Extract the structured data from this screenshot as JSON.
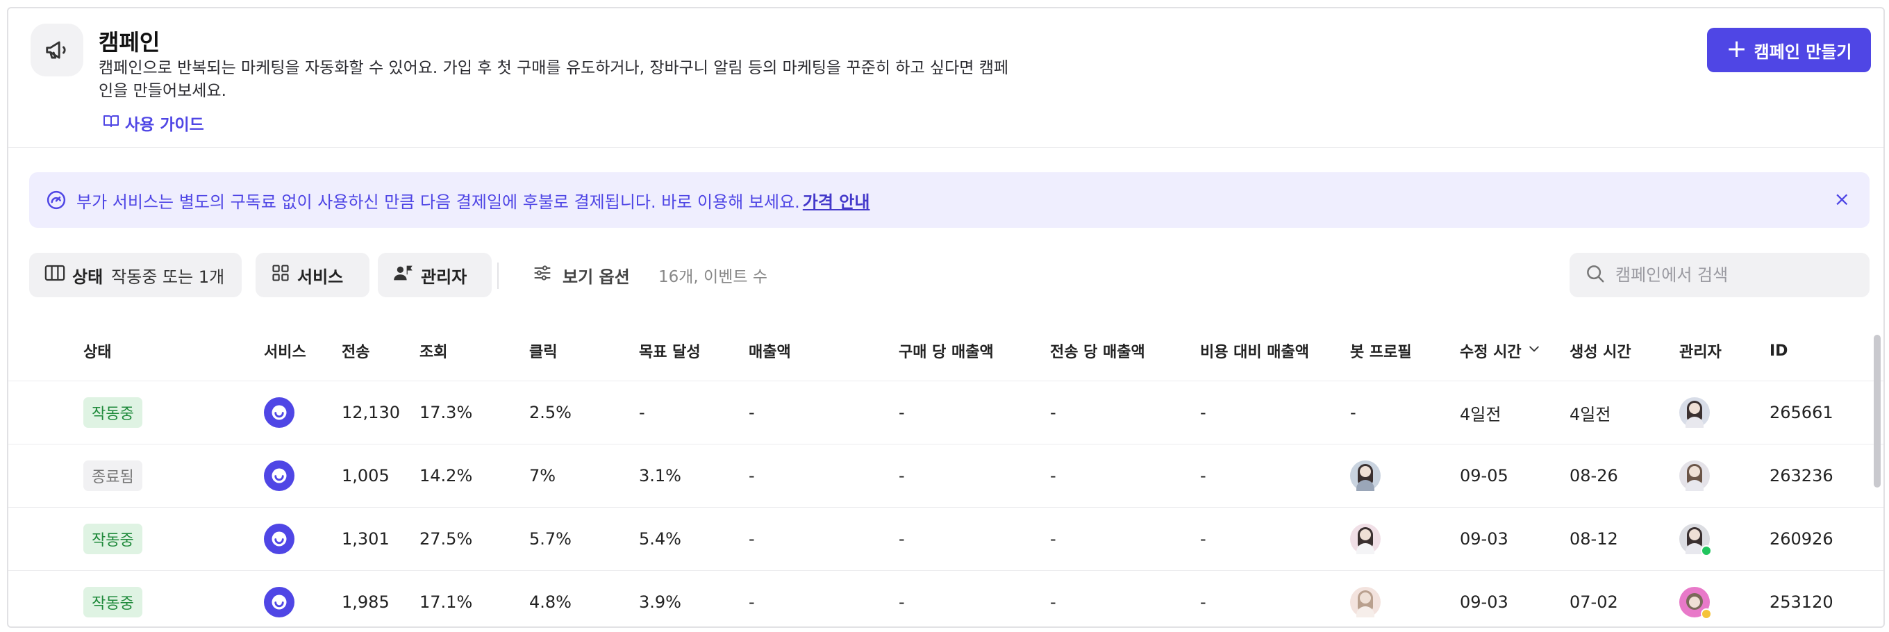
{
  "header": {
    "icon": "megaphone-icon",
    "title": "캠페인",
    "description": "캠페인으로 반복되는 마케팅을 자동화할 수 있어요. 가입 후 첫 구매를 유도하거나, 장바구니 알림 등의 마케팅을 꾸준히 하고 싶다면 캠페인을 만들어보세요.",
    "guide_label": "사용 가이드",
    "create_label": "캠페인 만들기"
  },
  "banner": {
    "text": "부가 서비스는 별도의 구독료 없이 사용하신 만큼 다음 결제일에 후불로 결제됩니다. 바로 이용해 보세요.",
    "link_label": "가격 안내",
    "close_label": "×"
  },
  "filters": {
    "status_label": "상태",
    "status_value": "작동중 또는 1개",
    "service_label": "서비스",
    "manager_label": "관리자",
    "view_options_label": "보기 옵션",
    "count_text": "16개, 이벤트 수",
    "search_placeholder": "캠페인에서 검색"
  },
  "table": {
    "columns": [
      "상태",
      "서비스",
      "전송",
      "조회",
      "클릭",
      "목표 달성",
      "매출액",
      "구매 당 매출액",
      "전송 당 매출액",
      "비용 대비 매출액",
      "봇 프로필",
      "수정 시간",
      "생성 시간",
      "관리자",
      "ID"
    ],
    "sort_icon": "chevron-down-icon",
    "rows": [
      {
        "status": "작동중",
        "status_type": "active",
        "sent": "12,130",
        "view": "17.3%",
        "click": "2.5%",
        "goal": "-",
        "revenue": "-",
        "rev_per_purchase": "-",
        "rev_per_send": "-",
        "roas": "-",
        "bot_profile": "-",
        "modified": "4일전",
        "created": "4일전",
        "id": "265661"
      },
      {
        "status": "종료됨",
        "status_type": "ended",
        "sent": "1,005",
        "view": "14.2%",
        "click": "7%",
        "goal": "3.1%",
        "revenue": "-",
        "rev_per_purchase": "-",
        "rev_per_send": "-",
        "roas": "-",
        "bot_profile": "",
        "modified": "09-05",
        "created": "08-26",
        "id": "263236"
      },
      {
        "status": "작동중",
        "status_type": "active",
        "sent": "1,301",
        "view": "27.5%",
        "click": "5.7%",
        "goal": "5.4%",
        "revenue": "-",
        "rev_per_purchase": "-",
        "rev_per_send": "-",
        "roas": "-",
        "bot_profile": "",
        "modified": "09-03",
        "created": "08-12",
        "id": "260926"
      },
      {
        "status": "작동중",
        "status_type": "active",
        "sent": "1,985",
        "view": "17.1%",
        "click": "4.8%",
        "goal": "3.9%",
        "revenue": "-",
        "rev_per_purchase": "-",
        "rev_per_send": "-",
        "roas": "-",
        "bot_profile": "",
        "modified": "09-03",
        "created": "07-02",
        "id": "253120"
      }
    ]
  },
  "colors": {
    "accent": "#4f46e5",
    "banner_bg": "#efeefe",
    "active_badge_bg": "#dff3e3",
    "active_badge_text": "#1f8a3b",
    "ended_badge_bg": "#f1f1f3",
    "online_dot": "#22c55e"
  }
}
